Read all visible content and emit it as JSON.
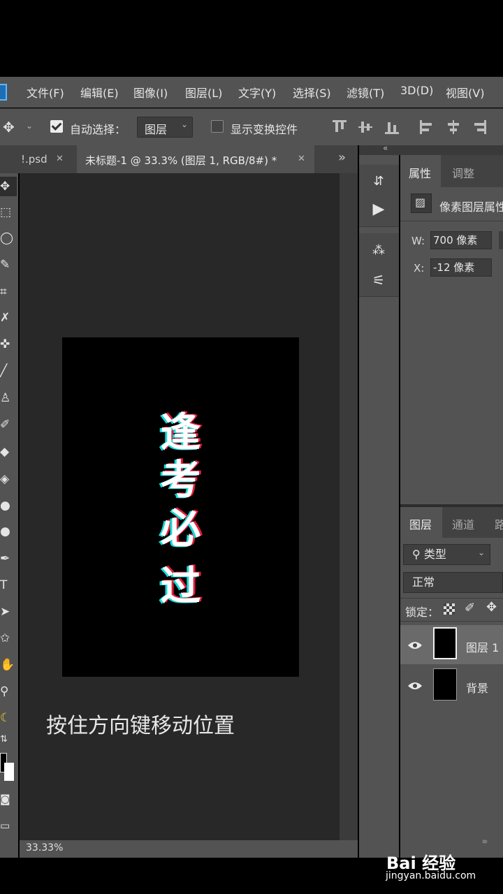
{
  "menu": {
    "items": [
      "文件(F)",
      "编辑(E)",
      "图像(I)",
      "图层(L)",
      "文字(Y)",
      "选择(S)",
      "滤镜(T)",
      "3D(D)",
      "视图(V)"
    ]
  },
  "options": {
    "auto_select_label": "自动选择：",
    "auto_select_target": "图层",
    "show_transform_label": "显示变换控件"
  },
  "tabs": {
    "inactive_label": "!.psd",
    "active_label": "未标题-1 @ 33.3% (图层 1, RGB/8#) *",
    "overflow": "»"
  },
  "canvas": {
    "glyphs": [
      "逢",
      "考",
      "必",
      "过"
    ],
    "caption": "按住方向键移动位置"
  },
  "status": {
    "zoom": "33.33%"
  },
  "properties": {
    "tabs": [
      "属性",
      "调整"
    ],
    "layer_type": "像素图层属性",
    "w_label": "W:",
    "w_value": "700 像素",
    "x_label": "X:",
    "x_value": "-12 像素"
  },
  "layers": {
    "tabs": [
      "图层",
      "通道",
      "路"
    ],
    "filter_label": "类型",
    "blend_mode": "正常",
    "lock_label": "锁定：",
    "rows": [
      {
        "name": "图层 1"
      },
      {
        "name": "背景"
      }
    ]
  },
  "watermark": {
    "logo": "Bai 经验",
    "url": "jingyan.baidu.com"
  },
  "colors": {
    "panel": "#535353",
    "dark_panel": "#424242",
    "workspace": "#282828",
    "glitch_cyan": "#18d8d8",
    "glitch_red": "#e0203a"
  }
}
